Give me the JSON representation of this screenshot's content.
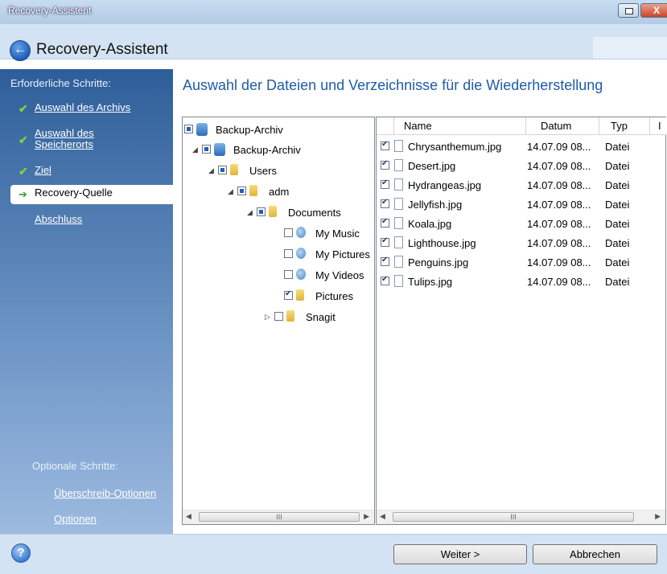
{
  "window": {
    "title": "Recovery-Assistent",
    "close_label": "X"
  },
  "header": {
    "title": "Recovery-Assistent"
  },
  "sidebar": {
    "required_heading": "Erforderliche Schritte:",
    "steps": [
      {
        "label": "Auswahl des Archivs",
        "state": "done"
      },
      {
        "label": "Auswahl des Speicherorts",
        "state": "done"
      },
      {
        "label": "Ziel",
        "state": "done"
      },
      {
        "label": "Recovery-Quelle",
        "state": "current"
      },
      {
        "label": "Abschluss",
        "state": "pending"
      }
    ],
    "optional_heading": "Optionale Schritte:",
    "optional": [
      {
        "label": "Überschreib-Optionen"
      },
      {
        "label": "Optionen"
      }
    ]
  },
  "main": {
    "title": "Auswahl der Dateien und Verzeichnisse für die Wiederherstellung"
  },
  "tree": {
    "nodes": [
      {
        "label": "Backup-Archiv",
        "icon": "drive-icon",
        "check": "partial",
        "expander": ""
      },
      {
        "label": "Backup-Archiv",
        "icon": "drive-icon",
        "check": "partial",
        "expander": "◢"
      },
      {
        "label": "Users",
        "icon": "folder-icon",
        "check": "partial",
        "expander": "◢"
      },
      {
        "label": "adm",
        "icon": "folder-icon",
        "check": "partial",
        "expander": "◢"
      },
      {
        "label": "Documents",
        "icon": "folder-icon",
        "check": "partial",
        "expander": "◢"
      },
      {
        "label": "My Music",
        "icon": "user-folder-icon",
        "check": "unchecked",
        "expander": ""
      },
      {
        "label": "My Pictures",
        "icon": "user-folder-icon",
        "check": "unchecked",
        "expander": ""
      },
      {
        "label": "My Videos",
        "icon": "user-folder-icon",
        "check": "unchecked",
        "expander": ""
      },
      {
        "label": "Pictures",
        "icon": "folder-icon",
        "check": "checked",
        "expander": ""
      },
      {
        "label": "Snagit",
        "icon": "folder-icon",
        "check": "unchecked",
        "expander": "▷"
      }
    ],
    "scroll_thumb": "III"
  },
  "files": {
    "columns": [
      "Name",
      "Datum",
      "Typ",
      "I"
    ],
    "rows": [
      {
        "name": "Chrysanthemum.jpg",
        "date": "14.07.09 08...",
        "type": "Datei"
      },
      {
        "name": "Desert.jpg",
        "date": "14.07.09 08...",
        "type": "Datei"
      },
      {
        "name": "Hydrangeas.jpg",
        "date": "14.07.09 08...",
        "type": "Datei"
      },
      {
        "name": "Jellyfish.jpg",
        "date": "14.07.09 08...",
        "type": "Datei"
      },
      {
        "name": "Koala.jpg",
        "date": "14.07.09 08...",
        "type": "Datei"
      },
      {
        "name": "Lighthouse.jpg",
        "date": "14.07.09 08...",
        "type": "Datei"
      },
      {
        "name": "Penguins.jpg",
        "date": "14.07.09 08...",
        "type": "Datei"
      },
      {
        "name": "Tulips.jpg",
        "date": "14.07.09 08...",
        "type": "Datei"
      }
    ],
    "scroll_thumb": "III"
  },
  "footer": {
    "help_label": "?",
    "next_label": "Weiter >",
    "cancel_label": "Abbrechen"
  }
}
